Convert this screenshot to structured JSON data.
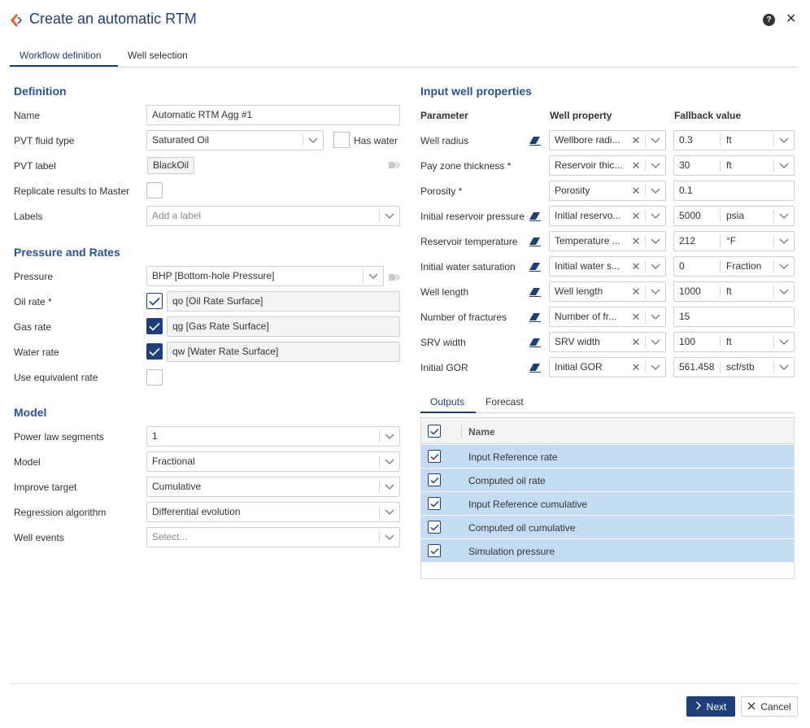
{
  "dialog": {
    "title": "Create an automatic RTM",
    "help_label": "?",
    "close_label": "✕"
  },
  "tabs": [
    {
      "label": "Workflow definition",
      "active": true
    },
    {
      "label": "Well selection",
      "active": false
    }
  ],
  "definition": {
    "heading": "Definition",
    "name_label": "Name",
    "name_value": "Automatic RTM Agg #1",
    "pvt_fluid_label": "PVT fluid type",
    "pvt_fluid_value": "Saturated Oil",
    "has_water_label": "Has water",
    "has_water_checked": false,
    "pvt_label_label": "PVT label",
    "pvt_label_value": "BlackOil",
    "replicate_label": "Replicate results to Master",
    "replicate_checked": false,
    "labels_label": "Labels",
    "labels_placeholder": "Add a label"
  },
  "pressure_rates": {
    "heading": "Pressure and Rates",
    "pressure_label": "Pressure",
    "pressure_value": "BHP [Bottom-hole Pressure]",
    "oil_label": "Oil rate",
    "oil_value": "qo [Oil Rate Surface]",
    "gas_label": "Gas rate",
    "gas_value": "qg [Gas Rate Surface]",
    "water_label": "Water rate",
    "water_value": "qw [Water Rate Surface]",
    "equiv_label": "Use equivalent rate"
  },
  "model": {
    "heading": "Model",
    "segments_label": "Power law segments",
    "segments_value": "1",
    "model_label": "Model",
    "model_value": "Fractional",
    "improve_label": "Improve target",
    "improve_value": "Cumulative",
    "regression_label": "Regression algorithm",
    "regression_value": "Differential evolution",
    "events_label": "Well events",
    "events_placeholder": "Select..."
  },
  "input_props": {
    "heading": "Input well properties",
    "col_parameter": "Parameter",
    "col_property": "Well property",
    "col_fallback": "Fallback value",
    "rows": [
      {
        "param": "Well radius",
        "required": false,
        "eraser": true,
        "property": "Wellbore radi...",
        "value": "0.3",
        "unit": "ft"
      },
      {
        "param": "Pay zone thickness",
        "required": true,
        "eraser": false,
        "property": "Reservoir thic...",
        "value": "30",
        "unit": "ft"
      },
      {
        "param": "Porosity",
        "required": true,
        "eraser": false,
        "property": "Porosity",
        "value": "0.1",
        "unit": ""
      },
      {
        "param": "Initial reservoir pressure",
        "required": false,
        "eraser": true,
        "property": "Initial reservo...",
        "value": "5000",
        "unit": "psia"
      },
      {
        "param": "Reservoir temperature",
        "required": false,
        "eraser": true,
        "property": "Temperature ...",
        "value": "212",
        "unit": "°F"
      },
      {
        "param": "Initial water saturation",
        "required": false,
        "eraser": true,
        "property": "Initial water s...",
        "value": "0",
        "unit": "Fraction"
      },
      {
        "param": "Well length",
        "required": false,
        "eraser": true,
        "property": "Well length",
        "value": "1000",
        "unit": "ft"
      },
      {
        "param": "Number of fractures",
        "required": false,
        "eraser": true,
        "property": "Number of fr...",
        "value": "15",
        "unit": ""
      },
      {
        "param": "SRV width",
        "required": false,
        "eraser": true,
        "property": "SRV width",
        "value": "100",
        "unit": "ft"
      },
      {
        "param": "Initial GOR",
        "required": false,
        "eraser": true,
        "property": "Initial GOR",
        "value": "561.458",
        "unit": "scf/stb"
      }
    ]
  },
  "subtabs": [
    {
      "label": "Outputs",
      "active": true
    },
    {
      "label": "Forecast",
      "active": false
    }
  ],
  "outputs": {
    "col_name": "Name",
    "rows": [
      {
        "name": "Input Reference rate",
        "checked": true
      },
      {
        "name": "Computed oil rate",
        "checked": true
      },
      {
        "name": "Input Reference cumulative",
        "checked": true
      },
      {
        "name": "Computed oil cumulative",
        "checked": true
      },
      {
        "name": "Simulation pressure",
        "checked": true
      }
    ]
  },
  "footer": {
    "next_label": "Next",
    "cancel_label": "Cancel"
  },
  "colors": {
    "primary": "#1e3f7a",
    "heading": "#2a5298",
    "row_selected": "#c4dcf3",
    "logo_orange": "#e8622a"
  }
}
